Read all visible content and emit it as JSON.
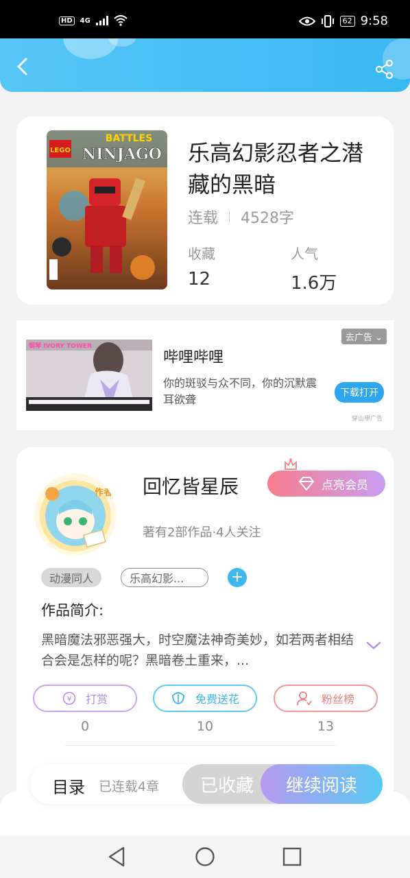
{
  "status_bar": {
    "hd": "HD",
    "network": "4G",
    "battery": "62",
    "time": "9:58"
  },
  "book": {
    "title": "乐高幻影忍者之潜藏的黑暗",
    "status": "连载",
    "word_count": "4528字",
    "stats": [
      {
        "label": "收藏",
        "value": "12"
      },
      {
        "label": "人气",
        "value": "1.6万"
      }
    ],
    "cover": {
      "brand": "LEGO",
      "line1": "BATTLES",
      "line2": "NINJAGO"
    }
  },
  "ad": {
    "title": "哔哩哔哩",
    "description": "你的斑驳与众不同，你的沉默震耳欲聋",
    "close_label": "去广告",
    "download_label": "下载打开",
    "source": "穿山甲广告",
    "image_caption": "钢琴 IVORY TOWER"
  },
  "author": {
    "badge": "作者",
    "name": "回忆皆星辰",
    "vip_label": "点亮会员",
    "meta": "著有2部作品·4人关注",
    "tags": [
      "动漫同人",
      "乐高幻影..."
    ],
    "intro_title": "作品简介:",
    "intro_text": "黑暗魔法邪恶强大，时空魔法神奇美妙，如若两者相结合会是怎样的呢？黑暗卷土重来，...",
    "actions": [
      {
        "label": "打赏",
        "count": "0"
      },
      {
        "label": "免费送花",
        "count": "10"
      },
      {
        "label": "粉丝榜",
        "count": "13"
      }
    ]
  },
  "bottom": {
    "toc_label": "目录",
    "toc_count": "已连载4章",
    "collected_label": "已收藏",
    "continue_label": "继续阅读"
  },
  "colors": {
    "accent": "#3bb8f0",
    "vip": "#f77d8b",
    "purple": "#b79af0"
  }
}
